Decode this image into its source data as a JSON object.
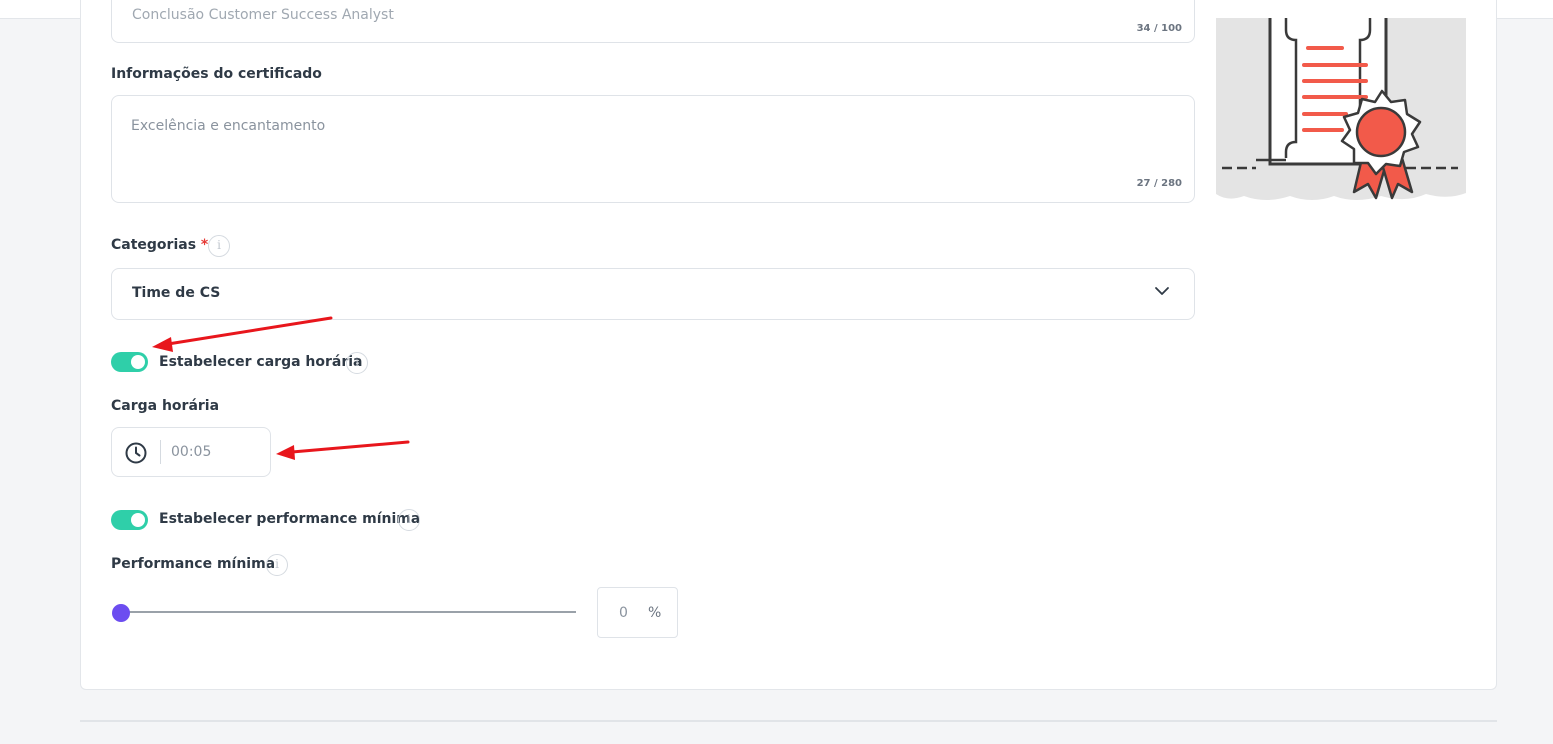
{
  "header": {
    "icons": [
      "logo-fragment",
      "header-icon-1",
      "header-icon-2",
      "header-icon-3"
    ]
  },
  "title_field": {
    "value": "Conclusão Customer Success Analyst",
    "counter": "34 / 100"
  },
  "certificate_info": {
    "label": "Informações do certificado",
    "value": "Excelência e encantamento",
    "counter": "27 / 280"
  },
  "categories": {
    "label": "Categorias",
    "required_mark": "*",
    "selected": "Time de CS"
  },
  "workload_toggle": {
    "label": "Estabelecer carga horária",
    "on": true
  },
  "workload": {
    "label": "Carga horária",
    "value": "00:05"
  },
  "performance_toggle": {
    "label": "Estabelecer performance mínima",
    "on": true
  },
  "performance": {
    "label": "Performance mínima",
    "value": "0",
    "unit": "%",
    "slider_level": 0
  },
  "info_icon_glyph": "i",
  "colors": {
    "toggle_on": "#2fcfa9",
    "slider_thumb": "#6c4df0",
    "annotation_arrow": "#e8161c",
    "certificate_accent": "#f25a4a"
  }
}
